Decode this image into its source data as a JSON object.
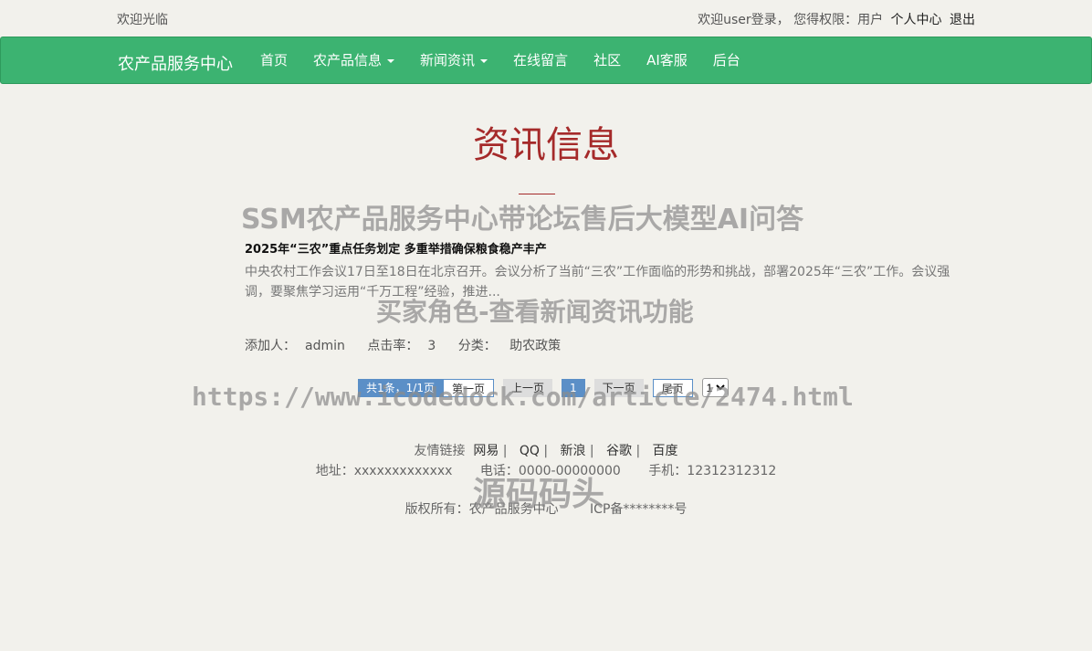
{
  "topbar": {
    "welcome": "欢迎光临",
    "login_status": "欢迎user登录，  您得权限：用户",
    "user_center": "个人中心",
    "logout": "退出"
  },
  "navbar": {
    "brand": "农产品服务中心",
    "items": [
      "首页",
      "农产品信息",
      "新闻资讯",
      "在线留言",
      "社区",
      "AI客服",
      "后台"
    ]
  },
  "page": {
    "title": "资讯信息"
  },
  "watermark": {
    "line1": "SSM农产品服务中心带论坛售后大模型AI问答",
    "line2": "买家角色-查看新闻资讯功能",
    "line3": "https://www.icodedock.com/article/2474.html",
    "line4": "源码码头"
  },
  "news": {
    "title": "2025年“三农”重点任务划定 多重举措确保粮食稳产丰产",
    "summary": "中央农村工作会议17日至18日在北京召开。会议分析了当前“三农”工作面临的形势和挑战，部署2025年“三农”工作。会议强调，要聚焦学习运用“千万工程”经验，推进...",
    "meta": {
      "adder_label": "添加人：",
      "adder": "admin",
      "clicks_label": "点击率：",
      "clicks": "3",
      "category_label": "分类：",
      "category": "助农政策"
    }
  },
  "pagination": {
    "total": "共1条，1/1页",
    "first": "第一页",
    "prev": "上一页",
    "current": "1",
    "next": "下一页",
    "last": "尾页",
    "select_value": "1"
  },
  "footer": {
    "links_label": "友情链接",
    "links": [
      "网易",
      "QQ",
      "新浪",
      "谷歌",
      "百度"
    ],
    "address": "地址：xxxxxxxxxxxxx",
    "phone": "电话：0000-00000000",
    "mobile": "手机：12312312312",
    "copyright": "版权所有：农产品服务中心",
    "icp": "ICP备********号"
  }
}
